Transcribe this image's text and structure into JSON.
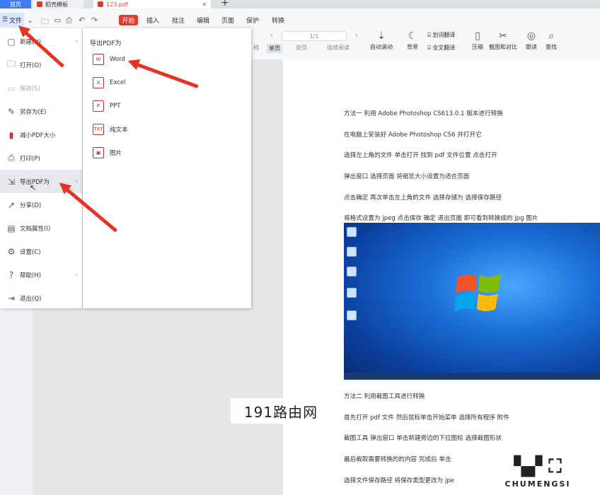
{
  "tabs": {
    "home": "首页",
    "template": "稻壳模板",
    "doc": "123.pdf",
    "close": "✕",
    "plus": "+"
  },
  "menubar": {
    "file": "文件",
    "items": [
      "开始",
      "插入",
      "批注",
      "编辑",
      "页面",
      "保护",
      "转换"
    ]
  },
  "toolbar": {
    "page_indicator": "1/1",
    "tools": [
      "划词翻译",
      "全文翻译",
      "压缩",
      "截图和对比",
      "朗读",
      "查找",
      "自动滚动",
      "背景"
    ],
    "view": [
      "档",
      "单页",
      "双页",
      "连续阅读"
    ]
  },
  "file_menu": [
    {
      "label": "新建(N)",
      "chevron": true
    },
    {
      "label": "打开(O)"
    },
    {
      "label": "保存(S)",
      "disabled": true
    },
    {
      "label": "另存为(E)"
    },
    {
      "label": "减小PDF大小"
    },
    {
      "label": "打印(P)"
    },
    {
      "label": "导出PDF为",
      "chevron": true,
      "active": true
    },
    {
      "label": "分享(D)"
    },
    {
      "label": "文档属性(I)"
    },
    {
      "label": "设置(C)"
    },
    {
      "label": "帮助(H)",
      "chevron": true
    },
    {
      "label": "退出(Q)"
    }
  ],
  "export_submenu": {
    "title": "导出PDF为",
    "items": [
      {
        "label": "Word",
        "icon": "W"
      },
      {
        "label": "Excel",
        "icon": "X"
      },
      {
        "label": "PPT",
        "icon": "P"
      },
      {
        "label": "纯文本",
        "icon": "TXT"
      },
      {
        "label": "图片",
        "icon": "▣"
      }
    ]
  },
  "document": {
    "lines": [
      "方法一  利用 Adobe Photoshop CS613.0.1 版本进行转换",
      "在电脑上安装好 Adobe Photoshop CS6 并打开它",
      "选择左上角的文件   单击打开   找到 pdf 文件位置   点击打开",
      "弹出窗口   选择页面   将缩览大小设置为适合页面",
      "点击确定   再次单击左上角的文件   选择存储为   选择保存路径",
      "将格式设置为 jpeg   点击保存   确定    退出页面   即可看到转换成的 jpg 图片"
    ],
    "lines2": [
      "方法二  利用截图工具进行转换",
      "首先打开 pdf 文件   然后鼠标单击开始菜单   选择所有程序   附件",
      "截图工具   弹出窗口   单击新建旁边的下拉图标   选择截图形状",
      "最后截取需要转换的的内容   完成后   单击",
      "选择文件保存路径   将保存类型更改为 jpe"
    ]
  },
  "watermark": {
    "site": "191路由网",
    "brand": "CHUMENGSI"
  },
  "colors": {
    "accent": "#3d7cf0",
    "red": "#e23b2e",
    "arrow": "#e53424"
  }
}
